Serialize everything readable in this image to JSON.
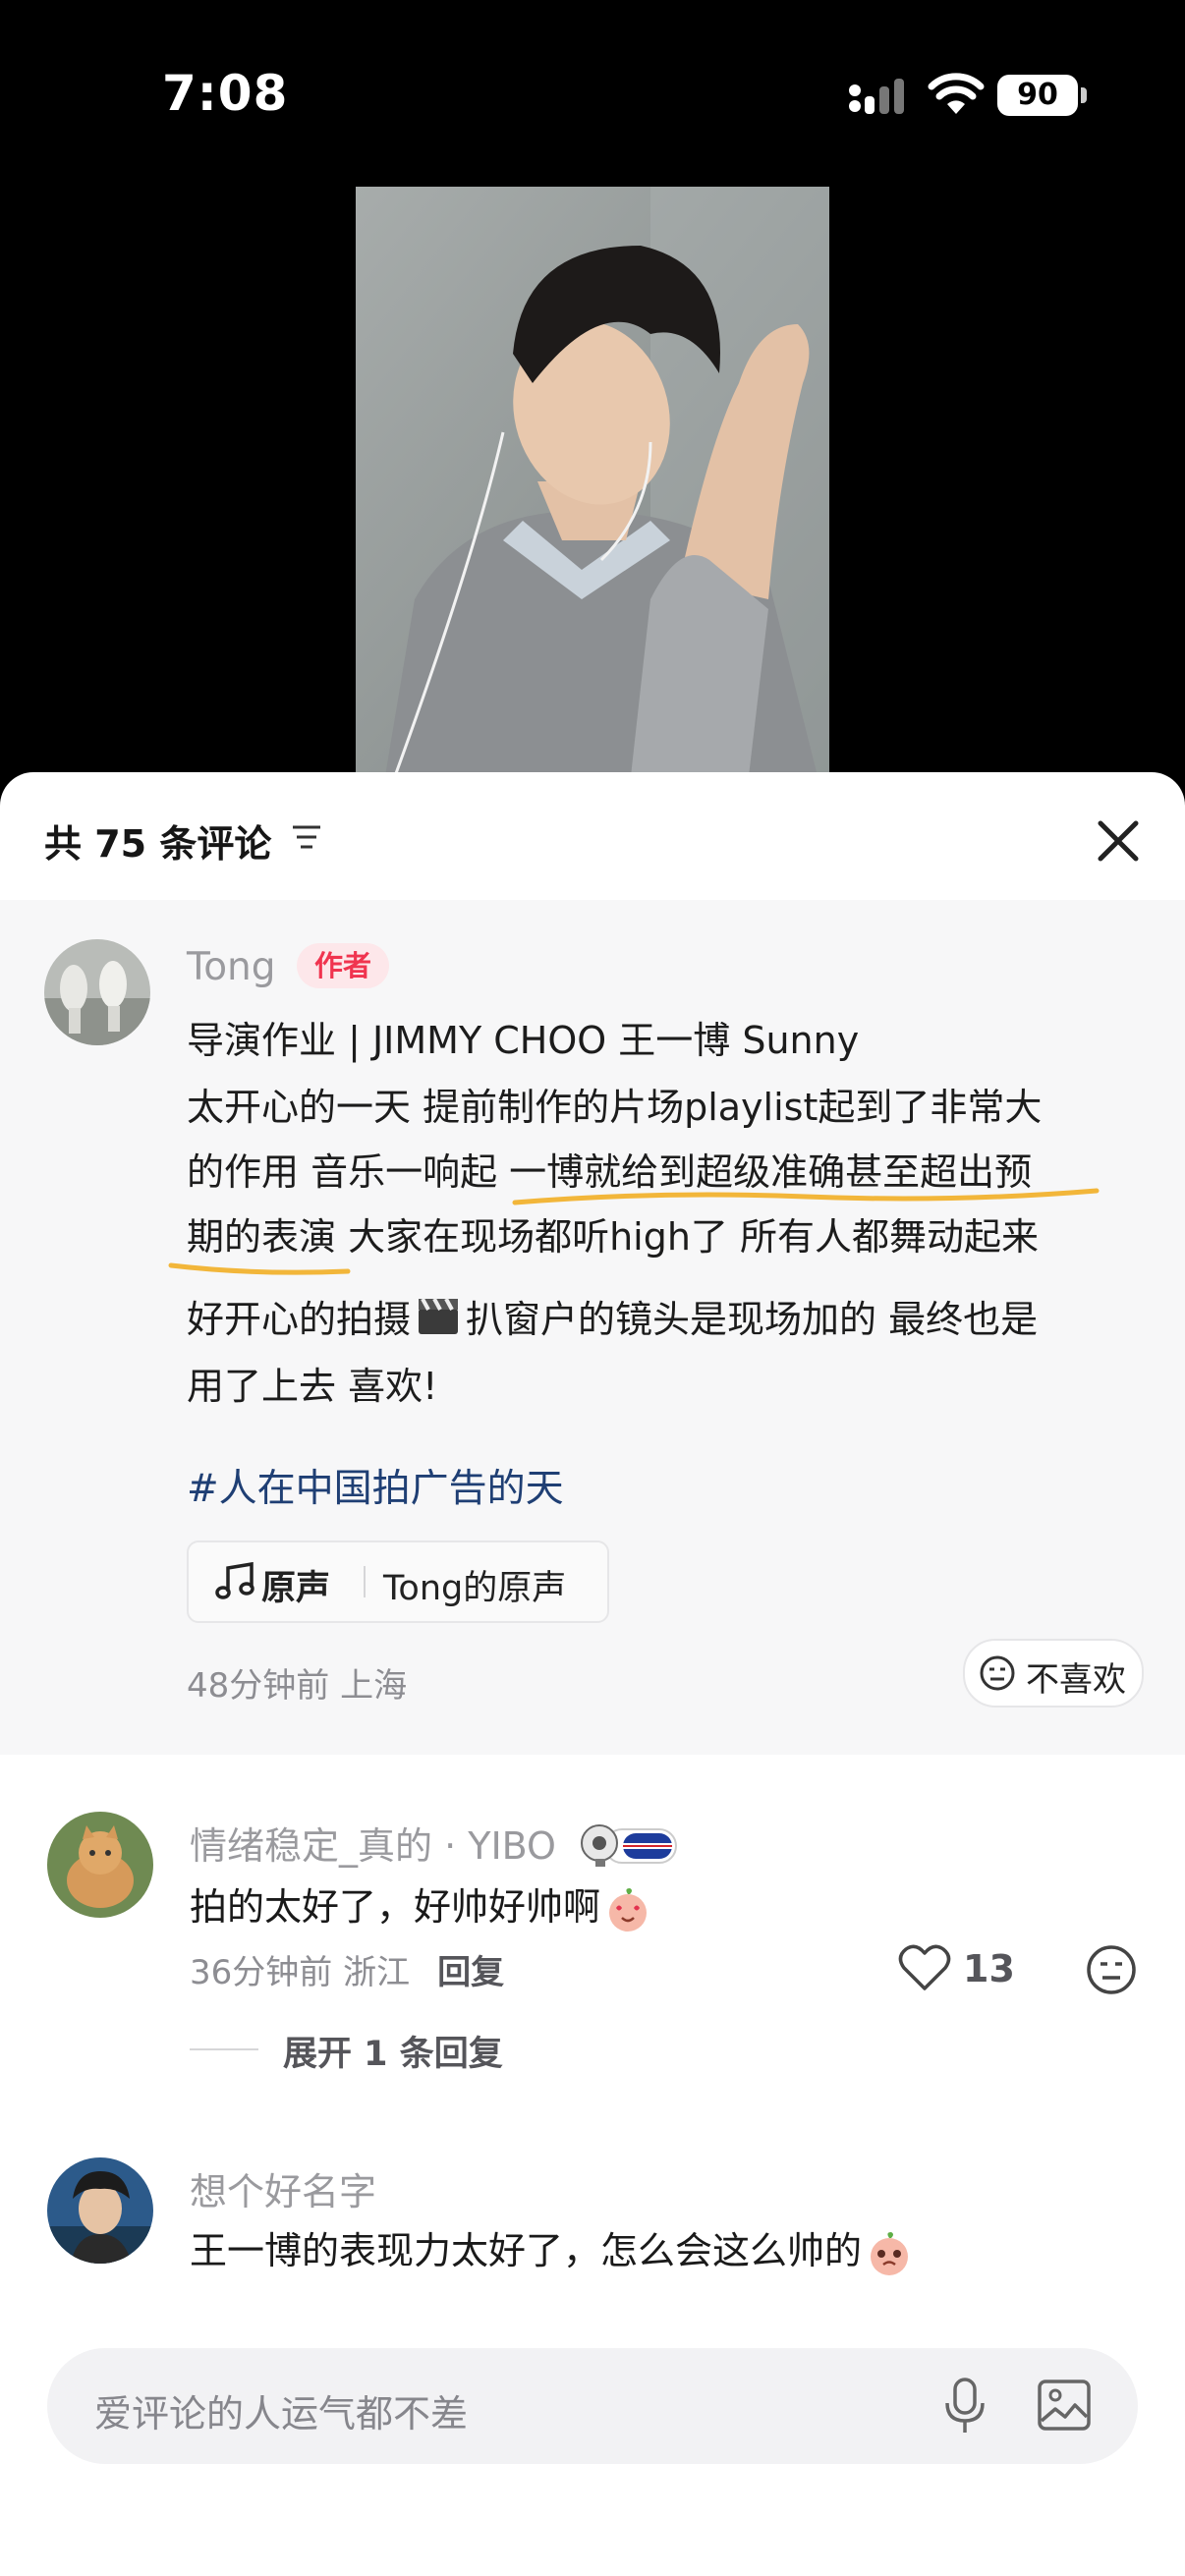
{
  "status_bar": {
    "time": "7:08",
    "battery": "90",
    "icons": [
      "signal-icon",
      "wifi-icon",
      "battery-icon"
    ]
  },
  "sheet": {
    "title": "共 75 条评论",
    "icons": [
      "filter-icon",
      "close-icon"
    ]
  },
  "author_post": {
    "name": "Tong",
    "badge": "作者",
    "lines": [
      "导演作业 | JIMMY CHOO 王一博 Sunny",
      "太开心的一天 提前制作的片场playlist起到了非常大",
      "的作用 音乐一响起 一博就给到超级准确甚至超出预",
      "期的表演 大家在现场都听high了 所有人都舞动起来",
      "好开心的拍摄",
      "扒窗户的镜头是现场加的 最终也是",
      "用了上去 喜欢!"
    ],
    "hashtag": "#人在中国拍广告的天",
    "music": {
      "label": "原声",
      "title": "Tong的原声"
    },
    "meta": "48分钟前 上海",
    "dislike_label": "不喜欢",
    "highlight_color": "#f2b63a"
  },
  "comments": [
    {
      "name": "情绪稳定_真的 · YIBO",
      "text": "拍的太好了，好帅好帅啊",
      "meta": "36分钟前 浙江",
      "reply": "回复",
      "likes": "13",
      "expand": "展开 1 条回复"
    },
    {
      "name": "想个好名字",
      "text": "王一博的表现力太好了，怎么会这么帅的"
    }
  ],
  "input": {
    "placeholder": "爱评论的人运气都不差",
    "icons": [
      "mic-icon",
      "image-icon"
    ]
  },
  "colors": {
    "accent": "#f0344f",
    "hashtag": "#1f3f74",
    "sheet_bg": "#ffffff",
    "post_bg": "#f7f7f8"
  }
}
